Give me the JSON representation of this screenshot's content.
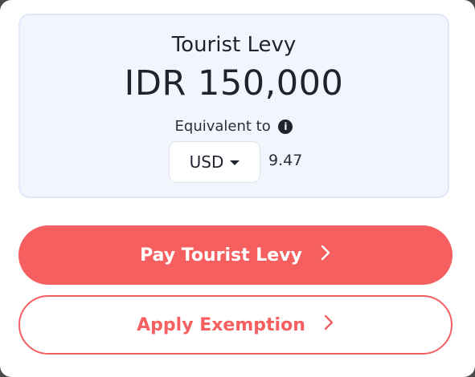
{
  "levy": {
    "title": "Tourist Levy",
    "amount": "IDR 150,000",
    "equivalent_label": "Equivalent to",
    "info_icon": "info-icon",
    "currency": "USD",
    "converted_value": "9.47"
  },
  "actions": {
    "pay_label": "Pay Tourist Levy",
    "exemption_label": "Apply Exemption"
  },
  "colors": {
    "accent": "#f55f60",
    "card_bg": "#f3f5fd",
    "text": "#1f2330"
  }
}
